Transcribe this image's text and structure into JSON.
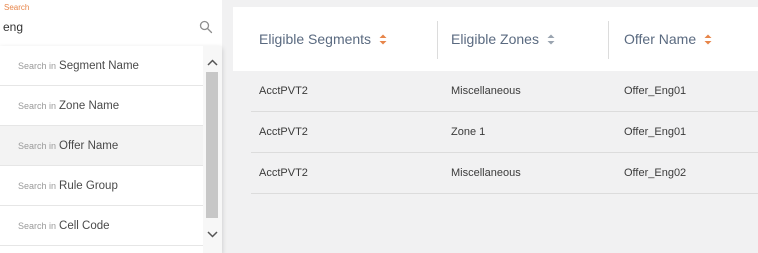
{
  "search": {
    "label": "Search",
    "value": "eng",
    "suggestions": [
      {
        "prefix": "Search in",
        "term": "Segment Name"
      },
      {
        "prefix": "Search in",
        "term": "Zone Name"
      },
      {
        "prefix": "Search in",
        "term": "Offer Name"
      },
      {
        "prefix": "Search in",
        "term": "Rule Group"
      },
      {
        "prefix": "Search in",
        "term": "Cell Code"
      }
    ],
    "active_suggestion": "Offer Name"
  },
  "table": {
    "columns": [
      "Eligible Segments",
      "Eligible Zones",
      "Offer Name"
    ],
    "rows": [
      [
        "AcctPVT2",
        "Miscellaneous",
        "Offer_Eng01"
      ],
      [
        "AcctPVT2",
        "Zone 1",
        "Offer_Eng01"
      ],
      [
        "AcctPVT2",
        "Miscellaneous",
        "Offer_Eng02"
      ]
    ]
  },
  "colors": {
    "accent_orange": "#e7854a",
    "header_text": "#5a6a80",
    "background": "#f1f1f2"
  },
  "icons": {
    "search": "search-icon",
    "sort": "sort-icon",
    "scroll_up": "chevron-up-icon",
    "scroll_down": "chevron-down-icon"
  }
}
